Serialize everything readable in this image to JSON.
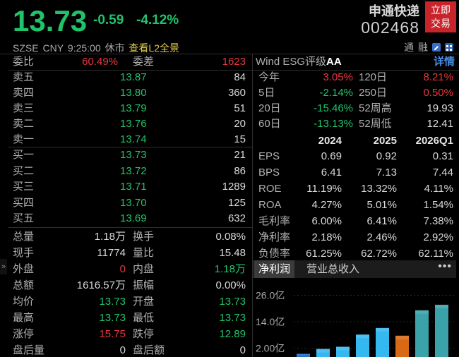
{
  "header": {
    "price": "13.73",
    "change": "-0.59",
    "change_pct": "-4.12%",
    "stock_name": "申通快递",
    "stock_code": "002468",
    "trade_button_line1": "立即",
    "trade_button_line2": "交易",
    "exchange": "SZSE",
    "currency": "CNY",
    "time": "9:25:00",
    "session_status": "休市",
    "l2_link": "查看L2全景",
    "tags": [
      "通",
      "融"
    ]
  },
  "orderbook": {
    "commission_ratio_label": "委比",
    "commission_ratio": "60.49%",
    "commission_diff_label": "委差",
    "commission_diff": "1623",
    "asks": [
      {
        "label": "卖五",
        "price": "13.87",
        "volume": "84"
      },
      {
        "label": "卖四",
        "price": "13.80",
        "volume": "360"
      },
      {
        "label": "卖三",
        "price": "13.79",
        "volume": "51"
      },
      {
        "label": "卖二",
        "price": "13.76",
        "volume": "20"
      },
      {
        "label": "卖一",
        "price": "13.74",
        "volume": "15"
      }
    ],
    "bids": [
      {
        "label": "买一",
        "price": "13.73",
        "volume": "21"
      },
      {
        "label": "买二",
        "price": "13.72",
        "volume": "86"
      },
      {
        "label": "买三",
        "price": "13.71",
        "volume": "1289"
      },
      {
        "label": "买四",
        "price": "13.70",
        "volume": "125"
      },
      {
        "label": "买五",
        "price": "13.69",
        "volume": "632"
      }
    ]
  },
  "stats": [
    {
      "l1": "总量",
      "v1": "1.18万",
      "c1": "white",
      "l2": "换手",
      "v2": "0.08%",
      "c2": "white"
    },
    {
      "l1": "现手",
      "v1": "11774",
      "c1": "white",
      "l2": "量比",
      "v2": "15.48",
      "c2": "white"
    },
    {
      "l1": "外盘",
      "v1": "0",
      "c1": "red",
      "l2": "内盘",
      "v2": "1.18万",
      "c2": "green"
    },
    {
      "l1": "总额",
      "v1": "1616.57万",
      "c1": "white",
      "l2": "振幅",
      "v2": "0.00%",
      "c2": "white"
    },
    {
      "l1": "均价",
      "v1": "13.73",
      "c1": "green",
      "l2": "开盘",
      "v2": "13.73",
      "c2": "green"
    },
    {
      "l1": "最高",
      "v1": "13.73",
      "c1": "green",
      "l2": "最低",
      "v2": "13.73",
      "c2": "green"
    },
    {
      "l1": "涨停",
      "v1": "15.75",
      "c1": "red",
      "l2": "跌停",
      "v2": "12.89",
      "c2": "green"
    },
    {
      "l1": "盘后量",
      "v1": "0",
      "c1": "white",
      "l2": "盘后额",
      "v2": "0",
      "c2": "white"
    }
  ],
  "esg": {
    "label": "Wind ESG评级",
    "rating": "AA",
    "detail": "详情"
  },
  "performance": [
    {
      "l1": "今年",
      "v1": "3.05%",
      "c1": "red",
      "l2": "120日",
      "v2": "8.21%",
      "c2": "red"
    },
    {
      "l1": "5日",
      "v1": "-2.14%",
      "c1": "green",
      "l2": "250日",
      "v2": "0.50%",
      "c2": "red"
    },
    {
      "l1": "20日",
      "v1": "-15.46%",
      "c1": "green",
      "l2": "52周高",
      "v2": "19.93",
      "c2": "white"
    },
    {
      "l1": "60日",
      "v1": "-13.13%",
      "c1": "green",
      "l2": "52周低",
      "v2": "12.41",
      "c2": "white"
    }
  ],
  "financials": {
    "columns": [
      "2024",
      "2025",
      "2026Q1"
    ],
    "rows": [
      {
        "label": "EPS",
        "values": [
          "0.69",
          "0.92",
          "0.31"
        ]
      },
      {
        "label": "BPS",
        "values": [
          "6.41",
          "7.13",
          "7.44"
        ]
      },
      {
        "label": "ROE",
        "values": [
          "11.19%",
          "13.32%",
          "4.11%"
        ]
      },
      {
        "label": "ROA",
        "values": [
          "4.27%",
          "5.01%",
          "1.54%"
        ]
      },
      {
        "label": "毛利率",
        "values": [
          "6.00%",
          "6.41%",
          "7.38%"
        ]
      },
      {
        "label": "净利率",
        "values": [
          "2.18%",
          "2.46%",
          "2.92%"
        ]
      },
      {
        "label": "负债率",
        "values": [
          "61.25%",
          "62.72%",
          "62.11%"
        ]
      }
    ]
  },
  "chart_tabs": {
    "active": "净利润",
    "inactive": "营业总收入",
    "more": "•••"
  },
  "chart_data": {
    "type": "bar",
    "y_ticks": [
      "26.0亿",
      "14.0亿",
      "2.00亿"
    ],
    "ylim": [
      0,
      30
    ],
    "bar_colors": [
      "#1f6fc8",
      "#35b8f0",
      "#d86a16",
      "#3aa2a8"
    ],
    "bars": [
      {
        "value": 0.8,
        "color": "#1f6fc8"
      },
      {
        "value": 3.0,
        "color": "#35b8f0"
      },
      {
        "value": 4.0,
        "color": "#35b8f0"
      },
      {
        "value": 9.5,
        "color": "#35b8f0"
      },
      {
        "value": 12.5,
        "color": "#35b8f0"
      },
      {
        "value": 9.0,
        "color": "#d86a16"
      },
      {
        "value": 20.5,
        "color": "#3aa2a8"
      },
      {
        "value": 23.0,
        "color": "#3aa2a8"
      }
    ]
  }
}
